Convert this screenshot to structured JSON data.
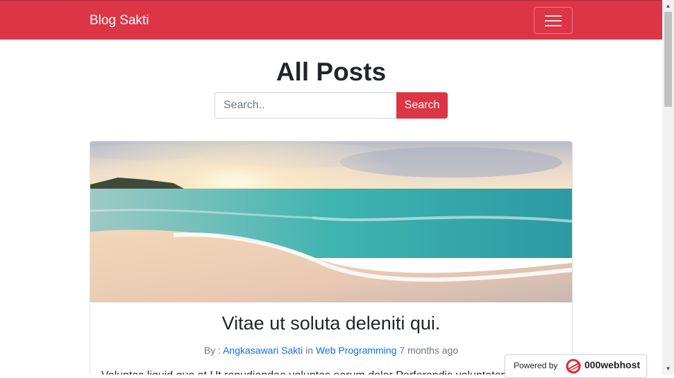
{
  "navbar": {
    "brand": "Blog Sakti",
    "toggler_icon": "hamburger-icon",
    "bg_color": "#dc3545"
  },
  "main": {
    "title": "All Posts",
    "search": {
      "placeholder": "Search..",
      "value": "",
      "button_label": "Search"
    }
  },
  "post": {
    "image_alt": "beach-sunset-image",
    "title": "Vitae ut soluta deleniti qui.",
    "meta": {
      "by_prefix": "By : ",
      "author": "Angkasawari Sakti",
      "in_word": " in ",
      "category": "Web Programming",
      "time": " 7 months ago"
    },
    "excerpt": "Voluptas liquid quo at Ut repudiandae voluptas earum dolor Perferendis voluptatem eos atque"
  },
  "badge": {
    "prefix": "Powered by",
    "brand": "000webhost",
    "icon": "000webhost-logo-icon"
  },
  "scrollbar": {
    "up_icon": "scroll-up-arrow-icon",
    "down_icon": "scroll-down-arrow-icon"
  }
}
